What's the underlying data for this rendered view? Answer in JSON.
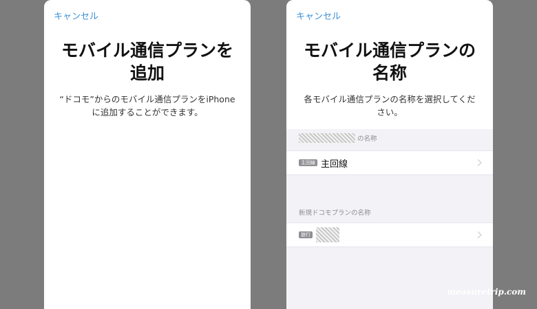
{
  "left_screen": {
    "cancel_label": "キャンセル",
    "title_line1": "モバイル通信プランを",
    "title_line2": "追加",
    "desc_line1": "“ドコモ”からのモバイル通信プランをiPhone",
    "desc_line2": "に追加することができます。"
  },
  "right_screen": {
    "cancel_label": "キャンセル",
    "title_line1": "モバイル通信プランの",
    "title_line2": "名称",
    "desc_line1": "各モバイル通信プランの名称を選択してくだ",
    "desc_line2": "さい。",
    "section1": {
      "header_suffix": "の名称",
      "row": {
        "badge": "主回線",
        "label": "主回線"
      }
    },
    "section2": {
      "header": "新規ドコモプランの名称",
      "row": {
        "badge": "旅行"
      }
    }
  },
  "watermark": "measuretrip.com",
  "colors": {
    "accent": "#3b8fd6",
    "background": "#7c7c7c"
  }
}
